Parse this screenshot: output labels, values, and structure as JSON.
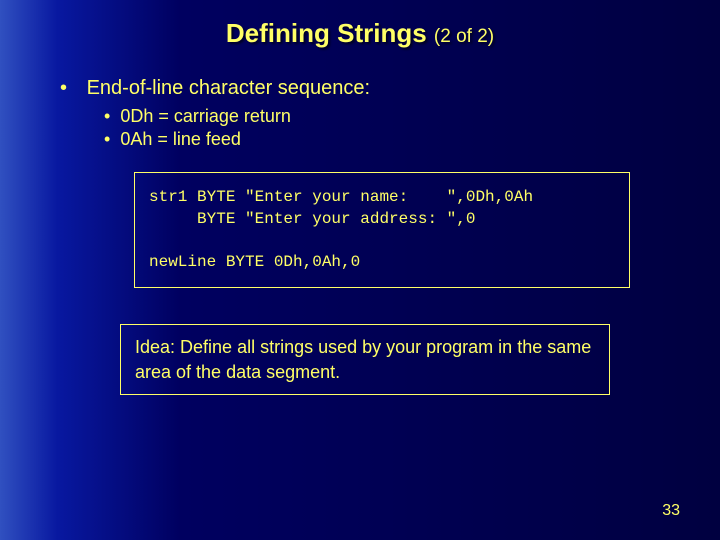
{
  "title": {
    "main": "Defining Strings",
    "sub": "(2 of 2)"
  },
  "bullets": {
    "heading": "End-of-line character sequence:",
    "items": [
      "0Dh = carriage return",
      "0Ah = line feed"
    ]
  },
  "code": "str1 BYTE \"Enter your name:    \",0Dh,0Ah\n     BYTE \"Enter your address: \",0\n\nnewLine BYTE 0Dh,0Ah,0",
  "idea": "Idea: Define all strings used by your program in the same area of the data segment.",
  "page_number": "33"
}
